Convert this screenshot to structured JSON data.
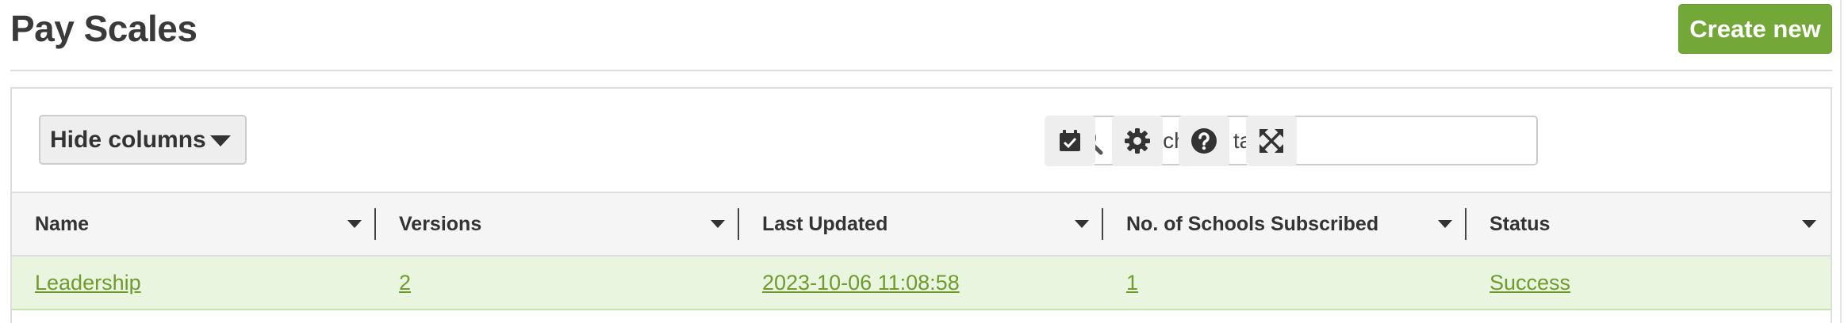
{
  "page": {
    "title": "Pay Scales",
    "create_label": "Create new"
  },
  "toolbar": {
    "hide_columns_label": "Hide columns",
    "search_placeholder": "Search this table"
  },
  "table": {
    "columns": [
      "Name",
      "Versions",
      "Last Updated",
      "No. of Schools Subscribed",
      "Status"
    ],
    "rows": [
      {
        "name": "Leadership",
        "versions": "2",
        "last_updated": "2023-10-06 11:08:58",
        "schools": "1",
        "status": "Success"
      }
    ]
  },
  "icons": {
    "search": "search-icon",
    "checklist": "calendar-check-icon",
    "settings": "gear-icon",
    "help": "question-circle-icon",
    "fullscreen": "expand-icon"
  },
  "colors": {
    "accent": "#73a737",
    "link": "#6f9a2d",
    "row_highlight": "#e9f5df"
  }
}
